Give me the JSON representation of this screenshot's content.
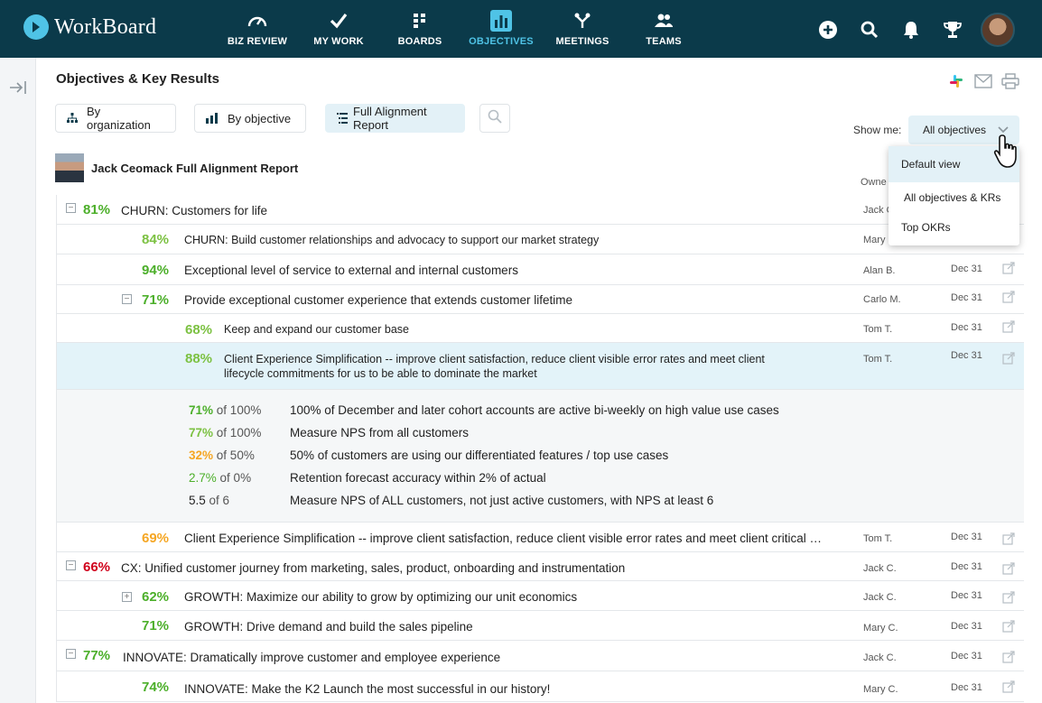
{
  "app": {
    "name": "WorkBoard"
  },
  "nav": [
    {
      "label": "BIZ REVIEW",
      "icon": "gauge-icon"
    },
    {
      "label": "MY WORK",
      "icon": "check-icon"
    },
    {
      "label": "BOARDS",
      "icon": "boards-icon"
    },
    {
      "label": "OBJECTIVES",
      "icon": "bar-chart-icon",
      "active": true
    },
    {
      "label": "MEETINGS",
      "icon": "meetings-icon"
    },
    {
      "label": "TEAMS",
      "icon": "people-icon"
    }
  ],
  "page": {
    "title": "Objectives & Key Results"
  },
  "views": {
    "by_org": "By organization",
    "by_objective": "By objective",
    "full_alignment": "Full Alignment Report"
  },
  "show_me": {
    "label": "Show me:",
    "selected": "All objectives",
    "options": [
      "Default view",
      "All objectives & KRs",
      "Top OKRs"
    ]
  },
  "report": {
    "name": "Jack Ceomack Full Alignment Report",
    "owner_col": "Owne"
  },
  "rows": [
    {
      "pct": "81%",
      "title": "CHURN: Customers for life",
      "owner": "Jack C",
      "date": ""
    },
    {
      "pct": "84%",
      "title": "CHURN: Build customer relationships and advocacy to support our market strategy",
      "owner": "Mary",
      "date": ""
    },
    {
      "pct": "94%",
      "title": "Exceptional level of service to external and internal customers",
      "owner": "Alan B.",
      "date": "Dec 31"
    },
    {
      "pct": "71%",
      "title": "Provide exceptional customer experience that extends customer lifetime",
      "owner": "Carlo M.",
      "date": "Dec 31"
    },
    {
      "pct": "68%",
      "title": "Keep and expand our customer base",
      "owner": "Tom T.",
      "date": "Dec 31"
    },
    {
      "pct": "88%",
      "title": "Client Experience Simplification -- improve client satisfaction, reduce client visible error rates and meet client lifecycle commitments for us to be able to dominate the market",
      "owner": "Tom T.",
      "date": "Dec 31"
    },
    {
      "pct": "69%",
      "title": "Client Experience Simplification -- improve client satisfaction, reduce client visible error rates and meet client critical …",
      "owner": "Tom T.",
      "date": "Dec 31"
    },
    {
      "pct": "66%",
      "title": "CX: Unified customer journey from marketing, sales, product, onboarding and instrumentation",
      "owner": "Jack C.",
      "date": "Dec 31"
    },
    {
      "pct": "62%",
      "title": "GROWTH: Maximize our ability to grow by optimizing our unit economics",
      "owner": "Jack C.",
      "date": "Dec 31"
    },
    {
      "pct": "71%",
      "title": "GROWTH: Drive demand and build the sales pipeline",
      "owner": "Mary C.",
      "date": "Dec 31"
    },
    {
      "pct": "77%",
      "title": "INNOVATE: Dramatically improve customer and employee experience",
      "owner": "Jack C.",
      "date": "Dec 31"
    },
    {
      "pct": "74%",
      "title": "INNOVATE: Make the K2 Launch the most successful in our history!",
      "owner": "Mary C.",
      "date": "Dec 31"
    }
  ],
  "krs": [
    {
      "value": "71%",
      "target": "of 100%",
      "text": "100% of December and later cohort accounts are active bi-weekly on high value use cases"
    },
    {
      "value": "77%",
      "target": "of 100%",
      "text": "Measure NPS from all customers"
    },
    {
      "value": "32%",
      "target": "of 50%",
      "text": "50% of customers are using our differentiated features / top use cases"
    },
    {
      "value": "2.7%",
      "target": "of 0%",
      "text": "Retention forecast accuracy within 2% of actual"
    },
    {
      "value": "5.5",
      "target": "of 6",
      "text": "Measure NPS of ALL customers, not just active customers, with NPS at least 6"
    }
  ]
}
